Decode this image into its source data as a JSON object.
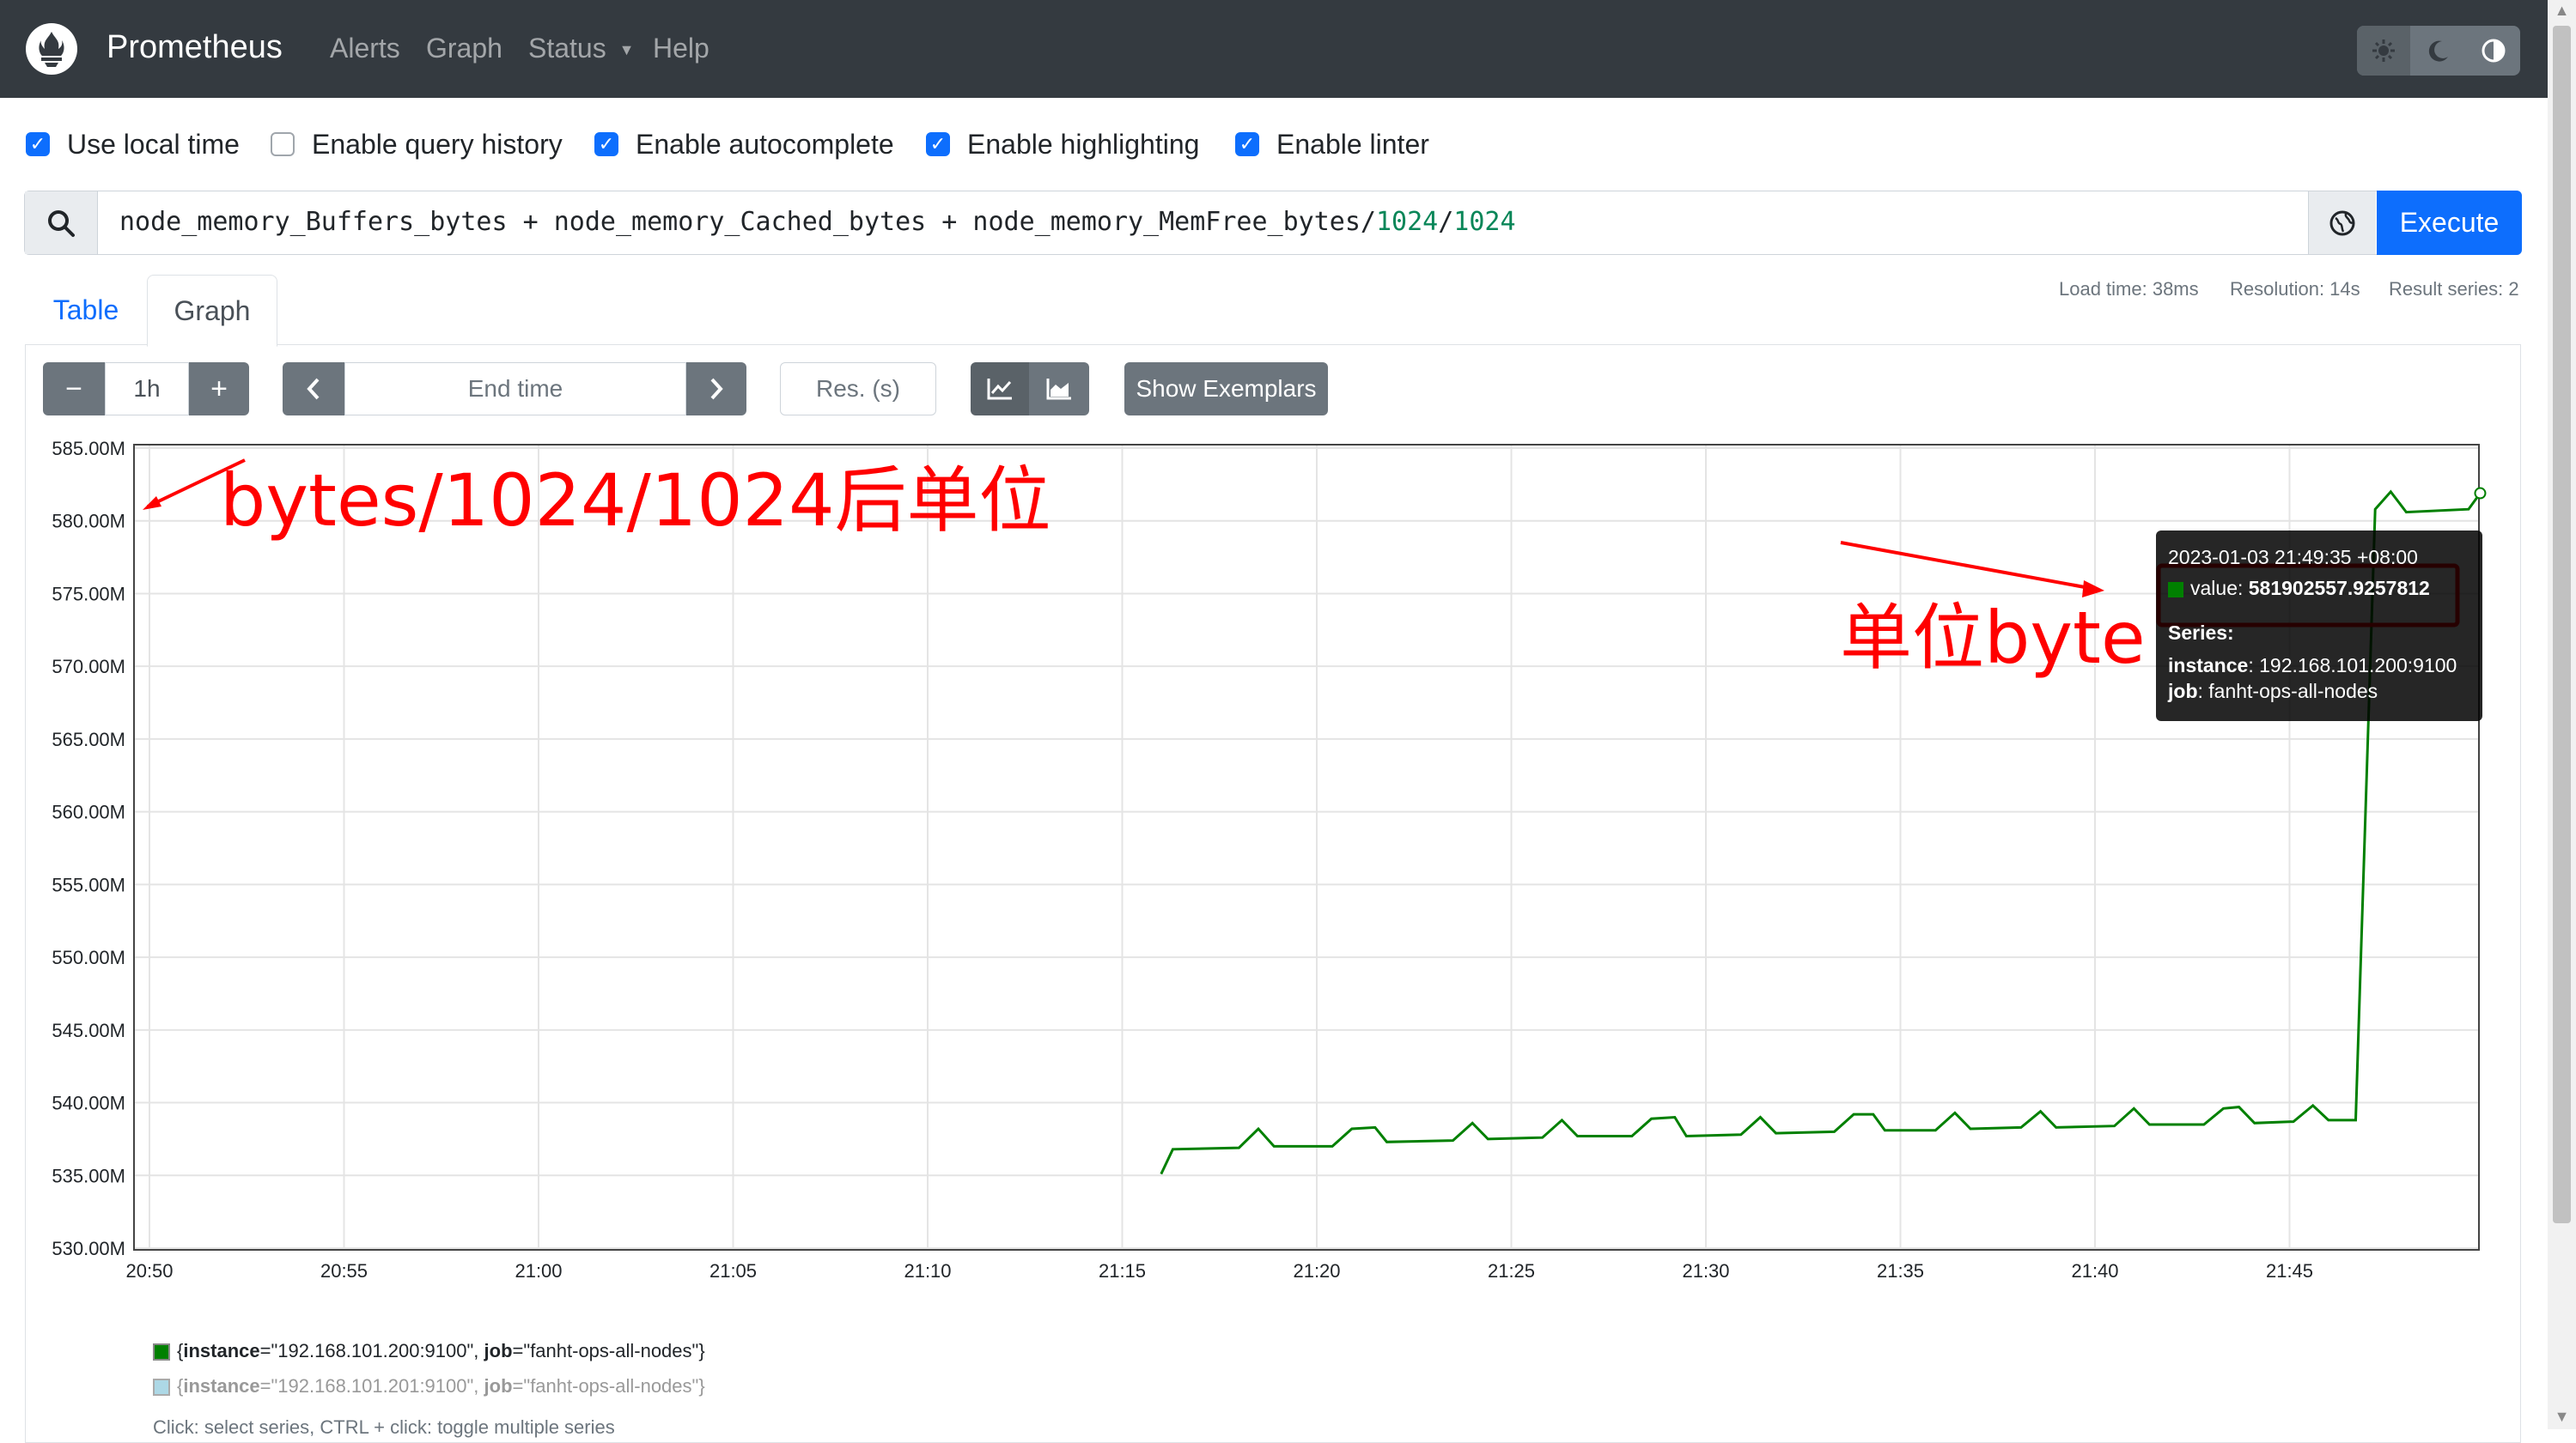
{
  "navbar": {
    "brand": "Prometheus",
    "items": [
      "Alerts",
      "Graph",
      "Status",
      "Help"
    ],
    "theme_icons": [
      "sun-icon",
      "moon-icon",
      "contrast-icon"
    ]
  },
  "options": [
    {
      "label": "Use local time",
      "checked": true
    },
    {
      "label": "Enable query history",
      "checked": false
    },
    {
      "label": "Enable autocomplete",
      "checked": true
    },
    {
      "label": "Enable highlighting",
      "checked": true
    },
    {
      "label": "Enable linter",
      "checked": true
    }
  ],
  "query": {
    "expr_main": "node_memory_Buffers_bytes + node_memory_Cached_bytes + node_memory_MemFree_bytes/",
    "num1": "1024",
    "slash": "/",
    "num2": "1024",
    "execute_label": "Execute"
  },
  "tabs": {
    "table": "Table",
    "graph": "Graph"
  },
  "stats": {
    "load_time": "Load time: 38ms",
    "resolution": "Resolution: 14s",
    "result_series": "Result series: 2"
  },
  "controls": {
    "minus": "−",
    "range": "1h",
    "plus": "+",
    "prev": "‹",
    "end_time_placeholder": "End time",
    "next": "›",
    "res_placeholder": "Res. (s)",
    "exemplars": "Show Exemplars"
  },
  "chart_data": {
    "type": "line",
    "y_ticks": [
      "585.00M",
      "580.00M",
      "575.00M",
      "570.00M",
      "565.00M",
      "560.00M",
      "555.00M",
      "550.00M",
      "545.00M",
      "540.00M",
      "535.00M",
      "530.00M"
    ],
    "x_ticks": [
      "20:50",
      "20:55",
      "21:00",
      "21:05",
      "21:10",
      "21:15",
      "21:20",
      "21:25",
      "21:30",
      "21:35",
      "21:40",
      "21:45"
    ],
    "ylim": [
      530,
      585
    ],
    "y_unit": "M",
    "x_range_minutes": [
      0,
      60
    ],
    "series": [
      {
        "name": "{instance=\"192.168.101.200:9100\", job=\"fanht-ops-all-nodes\"}",
        "color": "#008000",
        "points": [
          [
            26.0,
            535.1
          ],
          [
            26.3,
            536.8
          ],
          [
            28.0,
            536.9
          ],
          [
            28.5,
            538.2
          ],
          [
            28.9,
            537.0
          ],
          [
            30.4,
            537.0
          ],
          [
            30.9,
            538.2
          ],
          [
            31.5,
            538.3
          ],
          [
            31.8,
            537.3
          ],
          [
            33.5,
            537.4
          ],
          [
            34.0,
            538.6
          ],
          [
            34.4,
            537.5
          ],
          [
            35.8,
            537.6
          ],
          [
            36.3,
            538.8
          ],
          [
            36.7,
            537.7
          ],
          [
            38.1,
            537.7
          ],
          [
            38.6,
            538.9
          ],
          [
            39.2,
            539.0
          ],
          [
            39.5,
            537.7
          ],
          [
            40.9,
            537.8
          ],
          [
            41.4,
            539.0
          ],
          [
            41.8,
            537.9
          ],
          [
            43.3,
            538.0
          ],
          [
            43.8,
            539.2
          ],
          [
            44.3,
            539.2
          ],
          [
            44.6,
            538.1
          ],
          [
            45.9,
            538.1
          ],
          [
            46.4,
            539.3
          ],
          [
            46.8,
            538.2
          ],
          [
            48.1,
            538.3
          ],
          [
            48.6,
            539.4
          ],
          [
            49.0,
            538.3
          ],
          [
            50.5,
            538.4
          ],
          [
            51.0,
            539.6
          ],
          [
            51.4,
            538.5
          ],
          [
            52.8,
            538.5
          ],
          [
            53.3,
            539.6
          ],
          [
            53.7,
            539.7
          ],
          [
            54.1,
            538.6
          ],
          [
            55.1,
            538.7
          ],
          [
            55.6,
            539.8
          ],
          [
            56.0,
            538.8
          ],
          [
            56.7,
            538.8
          ],
          [
            57.2,
            580.8
          ],
          [
            57.6,
            582.0
          ],
          [
            58.0,
            580.6
          ],
          [
            59.6,
            580.8
          ],
          [
            59.9,
            581.9
          ]
        ]
      },
      {
        "name": "{instance=\"192.168.101.201:9100\", job=\"fanht-ops-all-nodes\"}",
        "color": "#add8e6",
        "points": []
      }
    ]
  },
  "tooltip": {
    "time": "2023-01-03 21:49:35 +08:00",
    "value_label": "value:",
    "value": "581902557.9257812",
    "series_label": "Series:",
    "instance_key": "instance",
    "instance_val": ": 192.168.101.200:9100",
    "job_key": "job",
    "job_val": ": fanht-ops-all-nodes"
  },
  "legend": [
    {
      "open": "{",
      "k1": "instance",
      "v1": "=\"192.168.101.200:9100\", ",
      "k2": "job",
      "v2": "=\"fanht-ops-all-nodes\"}",
      "color": "#008000"
    },
    {
      "open": "{",
      "k1": "instance",
      "v1": "=\"192.168.101.201:9100\", ",
      "k2": "job",
      "v2": "=\"fanht-ops-all-nodes\"}",
      "color": "#add8e6"
    }
  ],
  "help_text": "Click: select series, CTRL + click: toggle multiple series",
  "annotations": {
    "left": "bytes/1024/1024后单位",
    "right": "单位byte"
  }
}
